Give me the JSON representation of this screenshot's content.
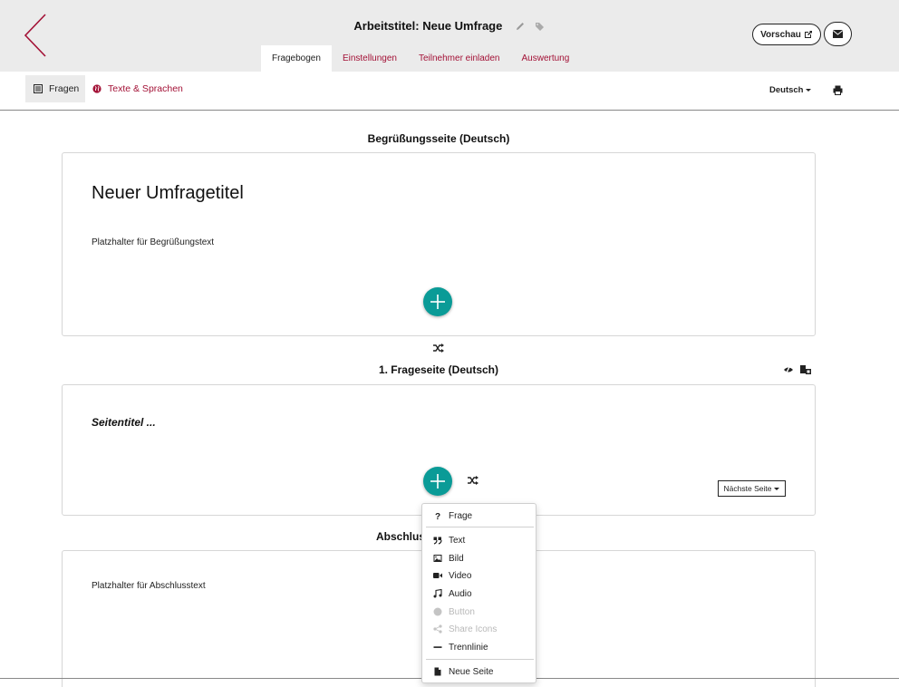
{
  "header": {
    "title": "Arbeitstitel: Neue Umfrage",
    "preview_label": "Vorschau",
    "tabs": [
      {
        "label": "Fragebogen",
        "active": true
      },
      {
        "label": "Einstellungen",
        "active": false
      },
      {
        "label": "Teilnehmer einladen",
        "active": false
      },
      {
        "label": "Auswertung",
        "active": false
      }
    ]
  },
  "subnav": {
    "fragen_label": "Fragen",
    "texte_label": "Texte & Sprachen",
    "language": "Deutsch"
  },
  "welcome": {
    "section_title": "Begrüßungsseite (Deutsch)",
    "heading": "Neuer Umfragetitel",
    "placeholder": "Platzhalter für Begrüßungstext"
  },
  "page1": {
    "section_title": "1. Frageseite (Deutsch)",
    "page_title": "Seitentitel ...",
    "next_page_label": "Nächste Seite"
  },
  "closing": {
    "section_title": "Abschlus",
    "placeholder": "Platzhalter für Abschlusstext"
  },
  "menu": {
    "items": [
      {
        "label": "Frage",
        "icon": "question-icon",
        "disabled": false
      },
      {
        "label": "Text",
        "icon": "quote-icon",
        "disabled": false
      },
      {
        "label": "Bild",
        "icon": "image-icon",
        "disabled": false
      },
      {
        "label": "Video",
        "icon": "video-icon",
        "disabled": false
      },
      {
        "label": "Audio",
        "icon": "music-icon",
        "disabled": false
      },
      {
        "label": "Button",
        "icon": "circle-icon",
        "disabled": true
      },
      {
        "label": "Share Icons",
        "icon": "share-icon",
        "disabled": true
      },
      {
        "label": "Trennlinie",
        "icon": "minus-icon",
        "disabled": false
      },
      {
        "label": "Neue Seite",
        "icon": "file-icon",
        "disabled": false
      }
    ]
  },
  "colors": {
    "accent": "#a31136",
    "add_button": "#0a9b97",
    "header_bg": "#ebebeb"
  }
}
